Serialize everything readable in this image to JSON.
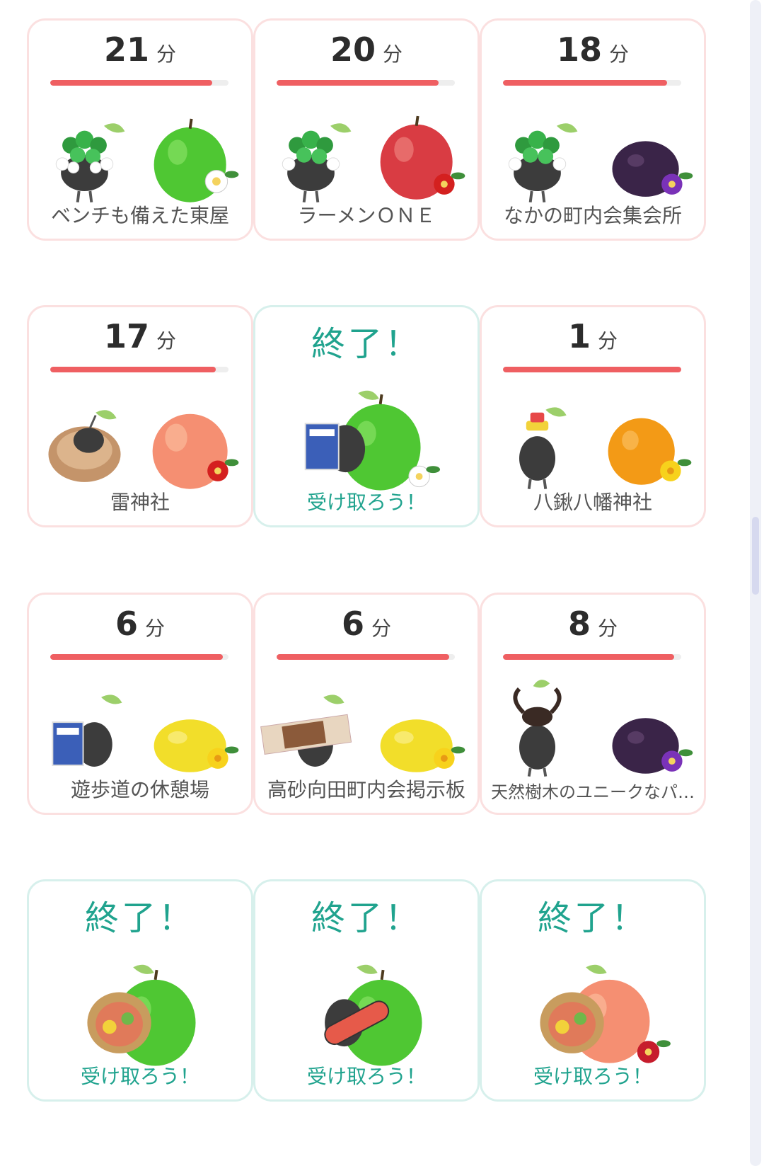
{
  "minute_unit": "分",
  "finished_label": "終了！",
  "claim_label": "受け取ろう！",
  "colors": {
    "running_border": "#fbe0e0",
    "done_border": "#d7f0ec",
    "progress": "#ef5f62",
    "done_text": "#20a38e"
  },
  "cards": [
    {
      "status": "running",
      "minutes": "21",
      "progress": 0.91,
      "location": "ベンチも備えた東屋",
      "pikmin": "clover-pikmin-icon",
      "fruit": "green-apple-icon",
      "flower": "white-flower-icon"
    },
    {
      "status": "running",
      "minutes": "20",
      "progress": 0.91,
      "location": "ラーメンＯＮＥ",
      "pikmin": "clover-pikmin-icon",
      "fruit": "red-apple-icon",
      "flower": "red-flower-icon"
    },
    {
      "status": "running",
      "minutes": "18",
      "progress": 0.92,
      "location": "なかの町内会集会所",
      "pikmin": "clover-pikmin-icon",
      "fruit": "plum-icon",
      "flower": "purple-flower-icon"
    },
    {
      "status": "running",
      "minutes": "17",
      "progress": 0.93,
      "location": "雷神社",
      "pikmin": "bagel-pikmin-icon",
      "fruit": "peach-icon",
      "flower": "red-flower-icon"
    },
    {
      "status": "done",
      "location": "",
      "pikmin": "book-pikmin-icon",
      "fruit": "green-apple-icon",
      "flower": "white-flower-icon"
    },
    {
      "status": "running",
      "minutes": "1",
      "progress": 1.0,
      "location": "八鍬八幡神社",
      "pikmin": "bottlecap-pikmin-icon",
      "fruit": "orange-icon",
      "flower": "yellow-flower-icon"
    },
    {
      "status": "running",
      "minutes": "6",
      "progress": 0.97,
      "location": "遊歩道の休憩場",
      "pikmin": "book-pikmin-icon",
      "fruit": "lemon-icon",
      "flower": "yellow-flower-icon"
    },
    {
      "status": "running",
      "minutes": "6",
      "progress": 0.97,
      "location": "高砂向田町内会掲示板",
      "pikmin": "snack-pikmin-icon",
      "fruit": "lemon-icon",
      "flower": "yellow-flower-icon"
    },
    {
      "status": "running",
      "minutes": "8",
      "progress": 0.96,
      "location": "天然樹木のユニークなパ…",
      "pikmin": "beetle-pikmin-icon",
      "fruit": "plum-icon",
      "flower": "purple-flower-icon"
    },
    {
      "status": "done",
      "location": "",
      "pikmin": "wrap-pikmin-icon",
      "fruit": "green-apple-icon",
      "flower": ""
    },
    {
      "status": "done",
      "location": "",
      "pikmin": "skateboard-pikmin-icon",
      "fruit": "green-apple-icon",
      "flower": ""
    },
    {
      "status": "done",
      "location": "",
      "pikmin": "wrap-pikmin-icon",
      "fruit": "peach-icon",
      "flower": "poinsettia-icon"
    }
  ]
}
